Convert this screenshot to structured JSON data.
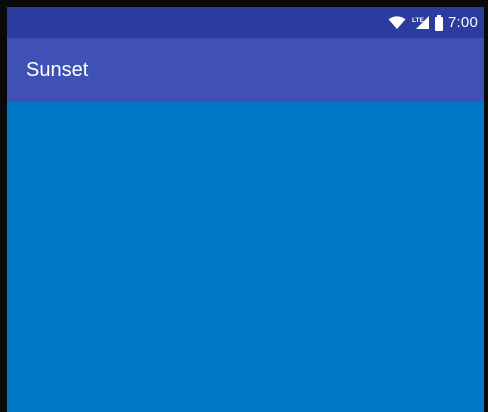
{
  "status_bar": {
    "time": "7:00",
    "network_label": "LTE",
    "icons": [
      "wifi-icon",
      "cellular-signal-icon",
      "battery-icon"
    ]
  },
  "app_bar": {
    "title": "Sunset"
  },
  "colors": {
    "status_bar": "#2B3B9E",
    "app_bar": "#3F51B5",
    "content_background": "#0078C8"
  }
}
